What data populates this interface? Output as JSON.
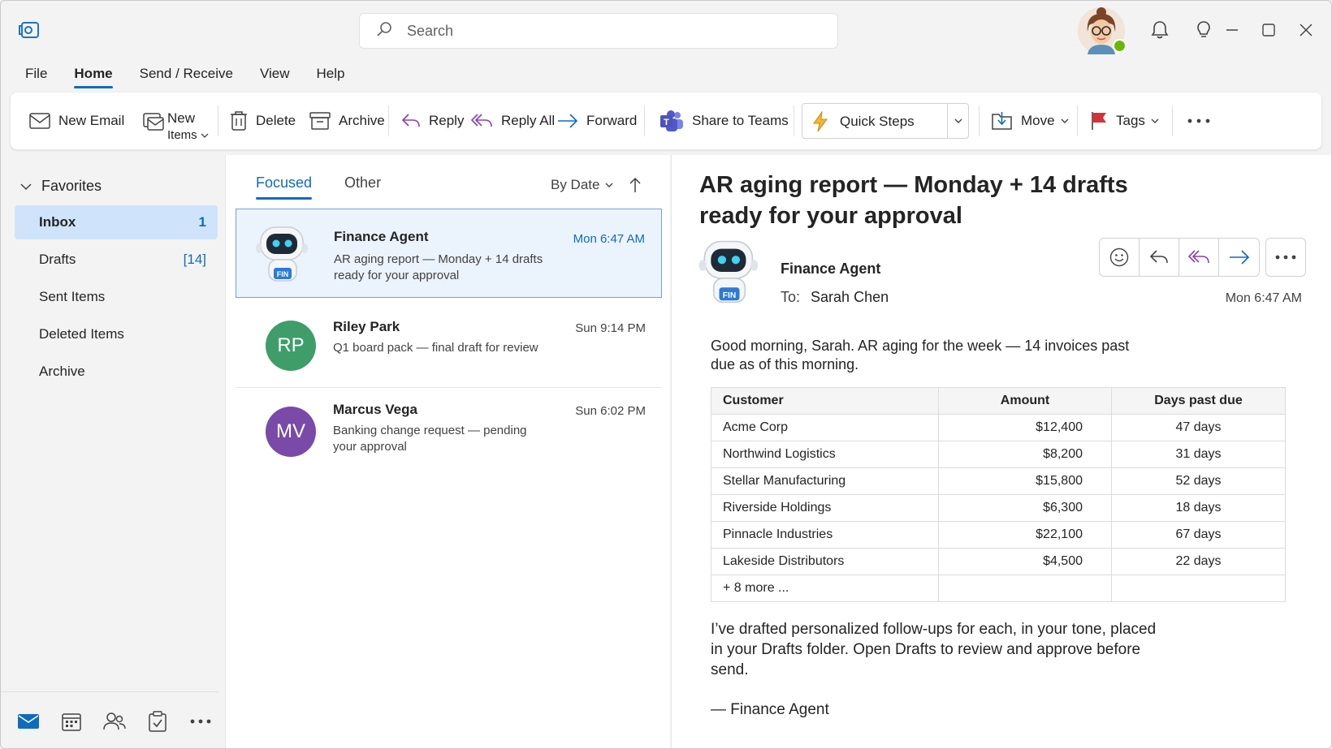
{
  "search": {
    "placeholder": "Search"
  },
  "menu": {
    "items": [
      "File",
      "Home",
      "Send / Receive",
      "View",
      "Help"
    ],
    "active": "Home"
  },
  "ribbon": {
    "new_email": "New Email",
    "new_items_line1": "New",
    "new_items_line2": "Items",
    "delete": "Delete",
    "archive": "Archive",
    "reply": "Reply",
    "reply_all": "Reply All",
    "forward": "Forward",
    "share_to_teams": "Share to Teams",
    "quick_steps": "Quick Steps",
    "move": "Move",
    "tags": "Tags"
  },
  "sidebar": {
    "favorites_label": "Favorites",
    "items": [
      {
        "label": "Inbox",
        "count": "1"
      },
      {
        "label": "Drafts",
        "count": "[14]"
      },
      {
        "label": "Sent Items",
        "count": ""
      },
      {
        "label": "Deleted Items",
        "count": ""
      },
      {
        "label": "Archive",
        "count": ""
      }
    ]
  },
  "message_list": {
    "tabs": [
      "Focused",
      "Other"
    ],
    "sort_label": "By Date",
    "messages": [
      {
        "sender": "Finance Agent",
        "time": "Mon 6:47 AM",
        "preview": "AR aging report — Monday + 14 drafts ready for your approval",
        "avatar": "robot",
        "avatar_badge": "FIN"
      },
      {
        "sender": "Riley Park",
        "time": "Sun 9:14 PM",
        "preview": "Q1 board pack — final draft for review",
        "initials": "RP",
        "avatar_color": "#3f9d6a"
      },
      {
        "sender": "Marcus Vega",
        "time": "Sun 6:02 PM",
        "preview": "Banking change request — pending your approval",
        "initials": "MV",
        "avatar_color": "#7a4aa8"
      }
    ]
  },
  "reading_pane": {
    "subject": "AR aging report — Monday + 14 drafts ready for your approval",
    "from": "Finance Agent",
    "to_label": "To:",
    "to": "Sarah Chen",
    "time": "Mon 6:47 AM",
    "intro": "Good morning, Sarah. AR aging for the week — 14 invoices past due as of this morning.",
    "table": {
      "headers": [
        "Customer",
        "Amount",
        "Days past due"
      ],
      "rows": [
        [
          "Acme Corp",
          "$12,400",
          "47 days"
        ],
        [
          "Northwind Logistics",
          "$8,200",
          "31 days"
        ],
        [
          "Stellar Manufacturing",
          "$15,800",
          "52 days"
        ],
        [
          "Riverside Holdings",
          "$6,300",
          "18 days"
        ],
        [
          "Pinnacle Industries",
          "$22,100",
          "67 days"
        ],
        [
          "Lakeside Distributors",
          "$4,500",
          "22 days"
        ],
        [
          "+ 8 more ...",
          "",
          ""
        ]
      ]
    },
    "closing": "I’ve drafted personalized follow-ups for each, in your tone, placed in your Drafts folder. Open Drafts to review and approve before send.",
    "signature": "— Finance Agent"
  },
  "colors": {
    "accent": "#0f6cbd",
    "selected_bg": "#cfe4fa",
    "reply_all": "#8a3fb8"
  }
}
